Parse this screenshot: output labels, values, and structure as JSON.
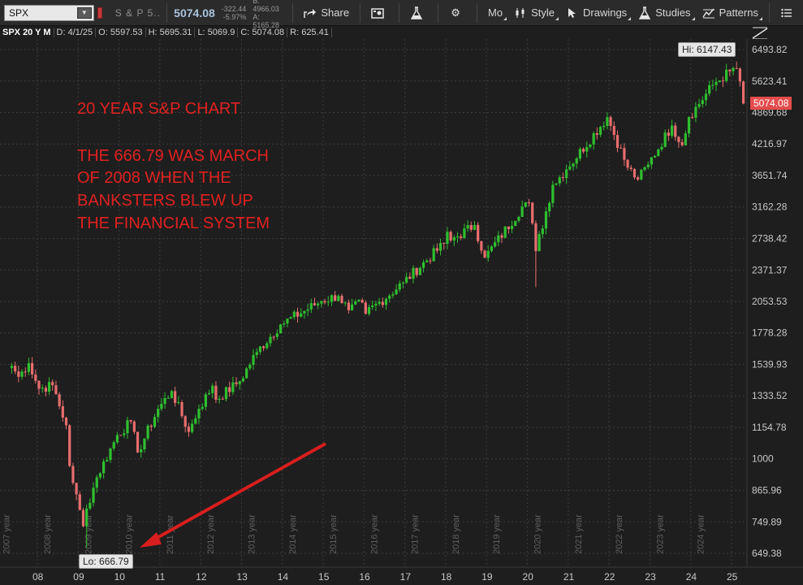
{
  "toolbar": {
    "symbol": "SPX",
    "description": "S & P 5...",
    "last_price": "5074.08",
    "net_change": "-322.44",
    "pct_change": "-5.97%",
    "bid": "B: 4966.03",
    "ask": "A: 5165.28",
    "share_label": "Share",
    "mo_label": "Mo",
    "style_label": "Style",
    "drawings_label": "Drawings",
    "studies_label": "Studies",
    "patterns_label": "Patterns"
  },
  "info_bar": {
    "title": "SPX 20 Y M",
    "date": "D: 4/1/25",
    "open": "O: 5597.53",
    "high": "H: 5695.31",
    "low": "L: 5069.9",
    "close": "C: 5074.08",
    "range": "R: 625.41"
  },
  "annotations": {
    "title": "20 YEAR S&P CHART",
    "line1": "THE 666.79 WAS MARCH",
    "line2": "OF 2008 WHEN THE",
    "line3": "BANKSTERS BLEW UP",
    "line4": "THE FINANCIAL SYSTEM"
  },
  "callouts": {
    "high": "Hi: 6147.43",
    "low": "Lo: 666.79",
    "last": "5074.08"
  },
  "colors": {
    "up": "#2fbf2f",
    "down": "#e86d6d",
    "annotation": "#e02020",
    "arrow": "#d81e1e"
  },
  "chart_data": {
    "type": "candlestick",
    "scale": "log",
    "y_ticks": [
      "6493.82",
      "5623.41",
      "4869.68",
      "4216.97",
      "3651.74",
      "3162.28",
      "2738.42",
      "2371.37",
      "2053.53",
      "1778.28",
      "1539.93",
      "1333.52",
      "1154.78",
      "1000",
      "865.96",
      "749.89",
      "649.38"
    ],
    "x_ticks": [
      "08",
      "09",
      "10",
      "11",
      "12",
      "13",
      "14",
      "15",
      "16",
      "17",
      "18",
      "19",
      "20",
      "21",
      "22",
      "23",
      "24",
      "25"
    ],
    "year_labels": [
      "2007 year",
      "2008 year",
      "2009 year",
      "2010 year",
      "2011 year",
      "2012 year",
      "2013 year",
      "2014 year",
      "2015 year",
      "2016 year",
      "2017 year",
      "2018 year",
      "2019 year",
      "2020 year",
      "2021 year",
      "2022 year",
      "2023 year",
      "2024 year"
    ],
    "high": 6147.43,
    "low": 666.79,
    "last": 5074.08,
    "anchors": [
      [
        "2007-05",
        1530
      ],
      [
        "2007-07",
        1455
      ],
      [
        "2007-10",
        1549
      ],
      [
        "2008-01",
        1378
      ],
      [
        "2008-05",
        1400
      ],
      [
        "2008-09",
        1166
      ],
      [
        "2008-10",
        968
      ],
      [
        "2008-11",
        896
      ],
      [
        "2009-02",
        735
      ],
      [
        "2009-03",
        797
      ],
      [
        "2009-06",
        919
      ],
      [
        "2009-12",
        1115
      ],
      [
        "2010-04",
        1186
      ],
      [
        "2010-06",
        1030
      ],
      [
        "2010-12",
        1257
      ],
      [
        "2011-04",
        1363
      ],
      [
        "2011-09",
        1131
      ],
      [
        "2011-12",
        1257
      ],
      [
        "2012-04",
        1397
      ],
      [
        "2012-05",
        1310
      ],
      [
        "2012-12",
        1426
      ],
      [
        "2013-05",
        1630
      ],
      [
        "2013-12",
        1848
      ],
      [
        "2014-12",
        2058
      ],
      [
        "2015-05",
        2107
      ],
      [
        "2015-08",
        1972
      ],
      [
        "2015-12",
        2043
      ],
      [
        "2016-01",
        1940
      ],
      [
        "2016-12",
        2238
      ],
      [
        "2017-12",
        2673
      ],
      [
        "2018-01",
        2823
      ],
      [
        "2018-02",
        2713
      ],
      [
        "2018-09",
        2913
      ],
      [
        "2018-12",
        2506
      ],
      [
        "2019-12",
        3230
      ],
      [
        "2020-01",
        3225
      ],
      [
        "2020-03",
        2584
      ],
      [
        "2020-08",
        3500
      ],
      [
        "2020-12",
        3756
      ],
      [
        "2021-12",
        4766
      ],
      [
        "2022-06",
        3785
      ],
      [
        "2022-09",
        3585
      ],
      [
        "2022-12",
        3839
      ],
      [
        "2023-07",
        4588
      ],
      [
        "2023-10",
        4193
      ],
      [
        "2023-12",
        4769
      ],
      [
        "2024-07",
        5522
      ],
      [
        "2024-12",
        5881
      ],
      [
        "2025-02",
        5954
      ],
      [
        "2025-03",
        5611
      ],
      [
        "2025-04",
        5074
      ]
    ]
  }
}
